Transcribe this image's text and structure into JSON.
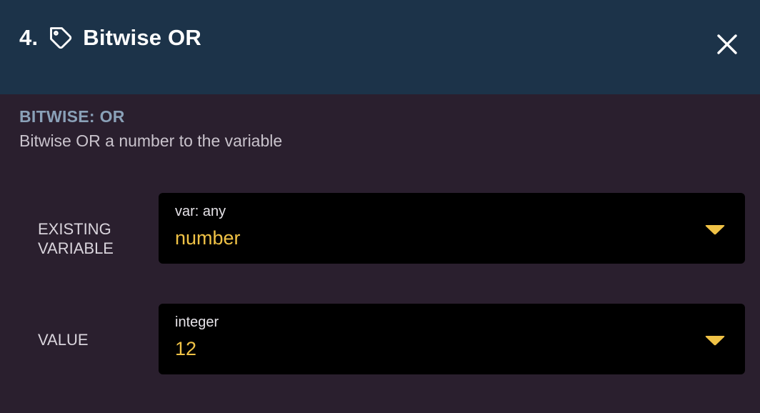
{
  "header": {
    "number": "4.",
    "title": "Bitwise OR",
    "icon": "tag-icon",
    "close_icon": "close-icon"
  },
  "section": {
    "title": "BITWISE: OR",
    "description": "Bitwise OR a number to the variable"
  },
  "fields": [
    {
      "label_line1": "EXISTING",
      "label_line2": "VARIABLE",
      "type": "var: any",
      "value": "number"
    },
    {
      "label": "VALUE",
      "type": "integer",
      "value": "12"
    }
  ],
  "colors": {
    "header_bg": "#1c3349",
    "body_bg": "#2a1f2e",
    "accent_value": "#f0c246",
    "section_title": "#8aa1b8"
  }
}
